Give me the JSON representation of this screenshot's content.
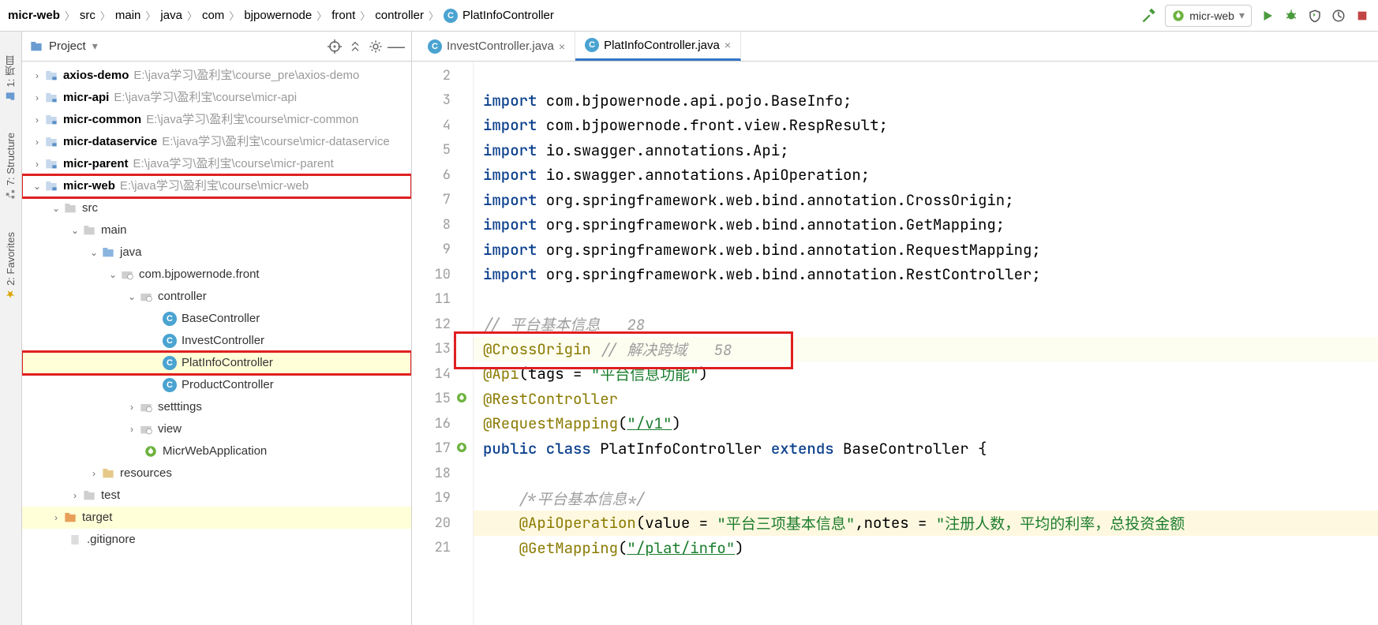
{
  "breadcrumb": [
    "micr-web",
    "src",
    "main",
    "java",
    "com",
    "bjpowernode",
    "front",
    "controller"
  ],
  "breadcrumb_file": "PlatInfoController",
  "run_config": "micr-web",
  "left_strip": {
    "project": "1: 项目",
    "structure": "7: Structure",
    "favorites": "2: Favorites"
  },
  "project_header": {
    "title": "Project"
  },
  "tree": {
    "axios_demo": {
      "name": "axios-demo",
      "path": "E:\\java学习\\盈利宝\\course_pre\\axios-demo"
    },
    "micr_api": {
      "name": "micr-api",
      "path": "E:\\java学习\\盈利宝\\course\\micr-api"
    },
    "micr_common": {
      "name": "micr-common",
      "path": "E:\\java学习\\盈利宝\\course\\micr-common"
    },
    "micr_dataservice": {
      "name": "micr-dataservice",
      "path": "E:\\java学习\\盈利宝\\course\\micr-dataservice"
    },
    "micr_parent": {
      "name": "micr-parent",
      "path": "E:\\java学习\\盈利宝\\course\\micr-parent"
    },
    "micr_web": {
      "name": "micr-web",
      "path": "E:\\java学习\\盈利宝\\course\\micr-web"
    },
    "src": "src",
    "main": "main",
    "java": "java",
    "pkg": "com.bjpowernode.front",
    "controller": "controller",
    "base_ctrl": "BaseController",
    "invest_ctrl": "InvestController",
    "platinfo_ctrl": "PlatInfoController",
    "product_ctrl": "ProductController",
    "settings": "setttings",
    "view": "view",
    "app": "MicrWebApplication",
    "resources": "resources",
    "test": "test",
    "target": "target",
    "gitignore": ".gitignore"
  },
  "tabs": {
    "invest": "InvestController.java",
    "platinfo": "PlatInfoController.java"
  },
  "gutter_start": 2,
  "code": {
    "l3": {
      "kw": "import",
      "rest": " com.bjpowernode.api.pojo.BaseInfo;"
    },
    "l4": {
      "kw": "import",
      "rest": " com.bjpowernode.front.view.RespResult;"
    },
    "l5": {
      "kw": "import",
      "rest": " io.swagger.annotations.Api;"
    },
    "l6": {
      "kw": "import",
      "rest": " io.swagger.annotations.ApiOperation;"
    },
    "l7": {
      "kw": "import",
      "rest": " org.springframework.web.bind.annotation.CrossOrigin;"
    },
    "l8": {
      "kw": "import",
      "rest": " org.springframework.web.bind.annotation.GetMapping;"
    },
    "l9": {
      "kw": "import",
      "rest": " org.springframework.web.bind.annotation.RequestMapping;"
    },
    "l10": {
      "kw": "import",
      "rest": " org.springframework.web.bind.annotation.RestController;"
    },
    "l12": "// 平台基本信息   28",
    "l13a": "@CrossOrigin",
    "l13b": " // 解决跨域   58",
    "l14a": "@Api",
    "l14b": "(tags = ",
    "l14c": "\"平台信息功能\"",
    "l14d": ")",
    "l15": "@RestController",
    "l16a": "@RequestMapping",
    "l16b": "(",
    "l16c": "\"/v1\"",
    "l16d": ")",
    "l17a": "public",
    "l17b": " class",
    "l17c": " PlatInfoController ",
    "l17d": "extends",
    "l17e": " BaseController {",
    "l19": "    /*平台基本信息*/",
    "l20a": "    @ApiOperation",
    "l20b": "(value = ",
    "l20c": "\"平台三项基本信息\"",
    "l20d": ",notes = ",
    "l20e": "\"注册人数，平均的利率，总投资金额",
    "l21a": "    @GetMapping",
    "l21b": "(",
    "l21c": "\"/plat/info\"",
    "l21d": ")"
  }
}
